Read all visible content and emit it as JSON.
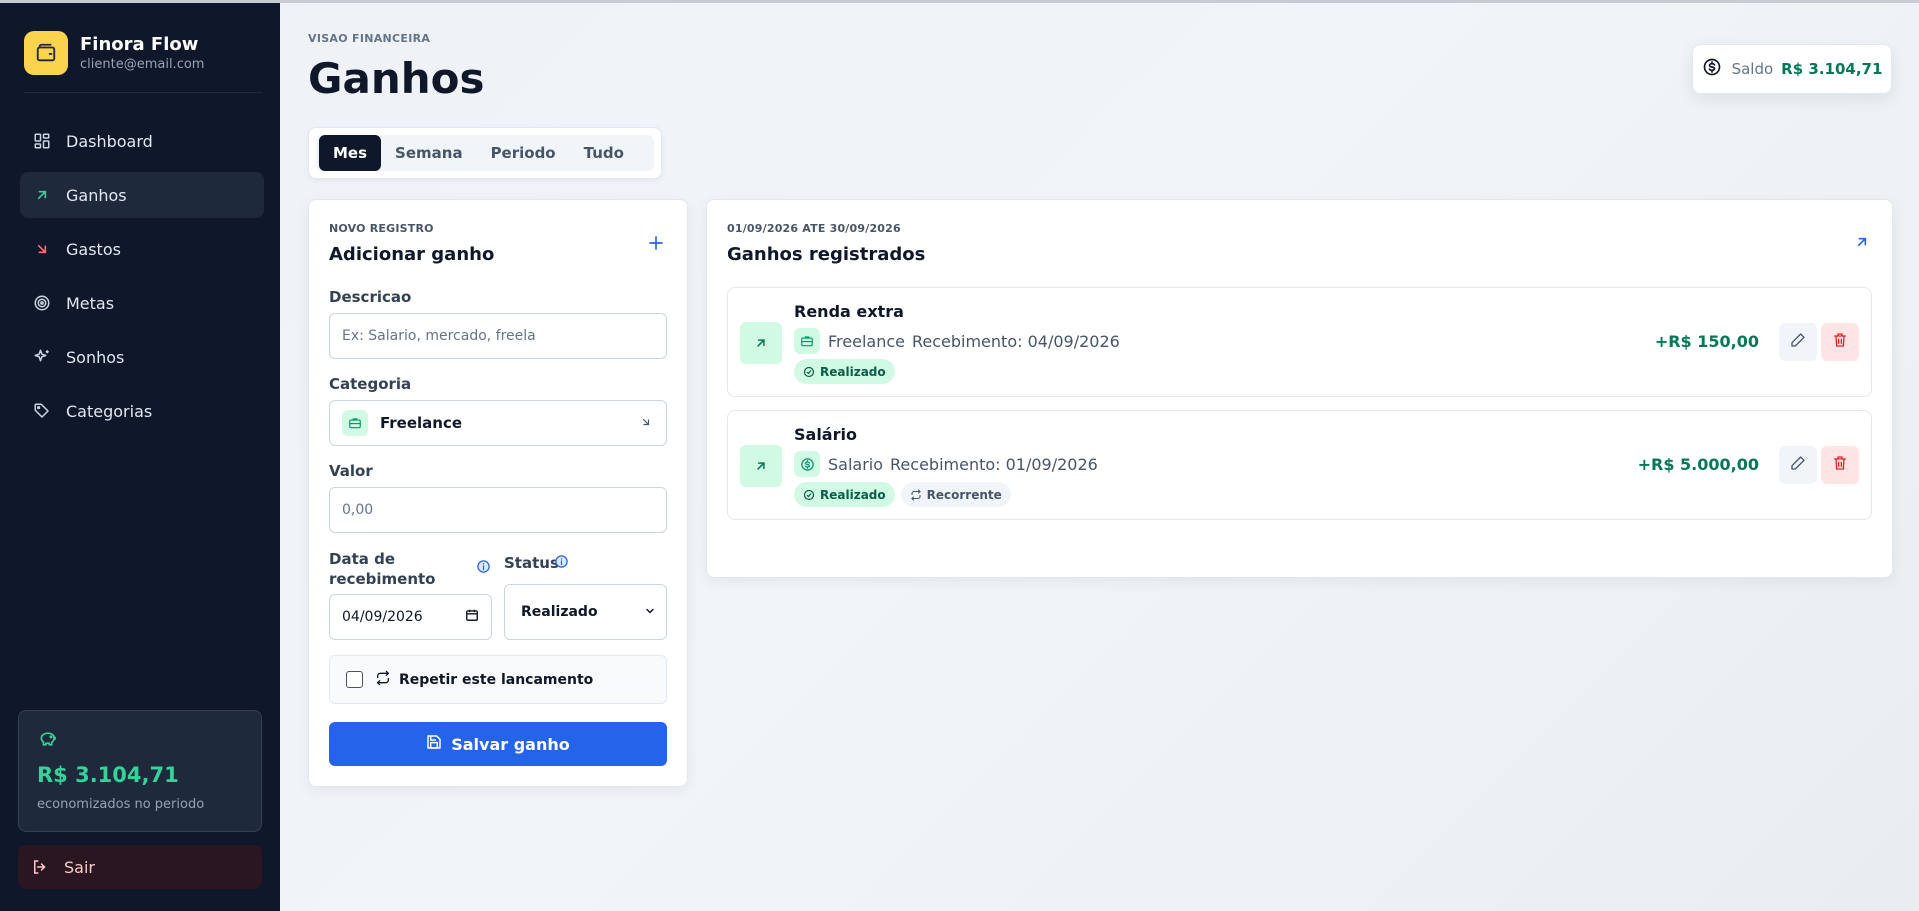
{
  "brand": {
    "name": "Finora Flow",
    "email": "cliente@email.com"
  },
  "sidebar": {
    "items": [
      {
        "label": "Dashboard",
        "icon": "dashboard-icon"
      },
      {
        "label": "Ganhos",
        "icon": "arrow-up-right-icon",
        "active": true
      },
      {
        "label": "Gastos",
        "icon": "arrow-down-right-icon"
      },
      {
        "label": "Metas",
        "icon": "target-icon"
      },
      {
        "label": "Sonhos",
        "icon": "sparkles-icon"
      },
      {
        "label": "Categorias",
        "icon": "tags-icon"
      }
    ],
    "savings": {
      "amount": "R$ 3.104,71",
      "label": "economizados no periodo"
    },
    "logout_label": "Sair"
  },
  "header": {
    "eyebrow": "VISAO FINANCEIRA",
    "title": "Ganhos",
    "balance_label": "Saldo",
    "balance_value": "R$ 3.104,71"
  },
  "tabs": [
    "Mes",
    "Semana",
    "Periodo",
    "Tudo"
  ],
  "form": {
    "eyebrow": "NOVO REGISTRO",
    "title": "Adicionar ganho",
    "description_label": "Descricao",
    "description_placeholder": "Ex: Salario, mercado, freela",
    "category_label": "Categoria",
    "category_value": "Freelance",
    "value_label": "Valor",
    "value_placeholder": "0,00",
    "date_label": "Data de recebimento",
    "date_value": "04/09/2026",
    "status_label": "Status",
    "status_value": "Realizado",
    "repeat_label": "Repetir este lancamento",
    "save_label": "Salvar ganho"
  },
  "list": {
    "period": "01/09/2026 ATE 30/09/2026",
    "title": "Ganhos registrados",
    "entries": [
      {
        "title": "Renda extra",
        "category": "Freelance",
        "date_text": "Recebimento: 04/09/2026",
        "status": "Realizado",
        "amount": "+R$ 150,00"
      },
      {
        "title": "Salário",
        "category": "Salario",
        "date_text": "Recebimento: 01/09/2026",
        "status": "Realizado",
        "recurring": "Recorrente",
        "amount": "+R$ 5.000,00"
      }
    ]
  },
  "colors": {
    "sidebar_bg": "#0f172a",
    "accent_blue": "#2563eb",
    "income_green": "#047857",
    "brand_yellow": "#fcd34d"
  }
}
